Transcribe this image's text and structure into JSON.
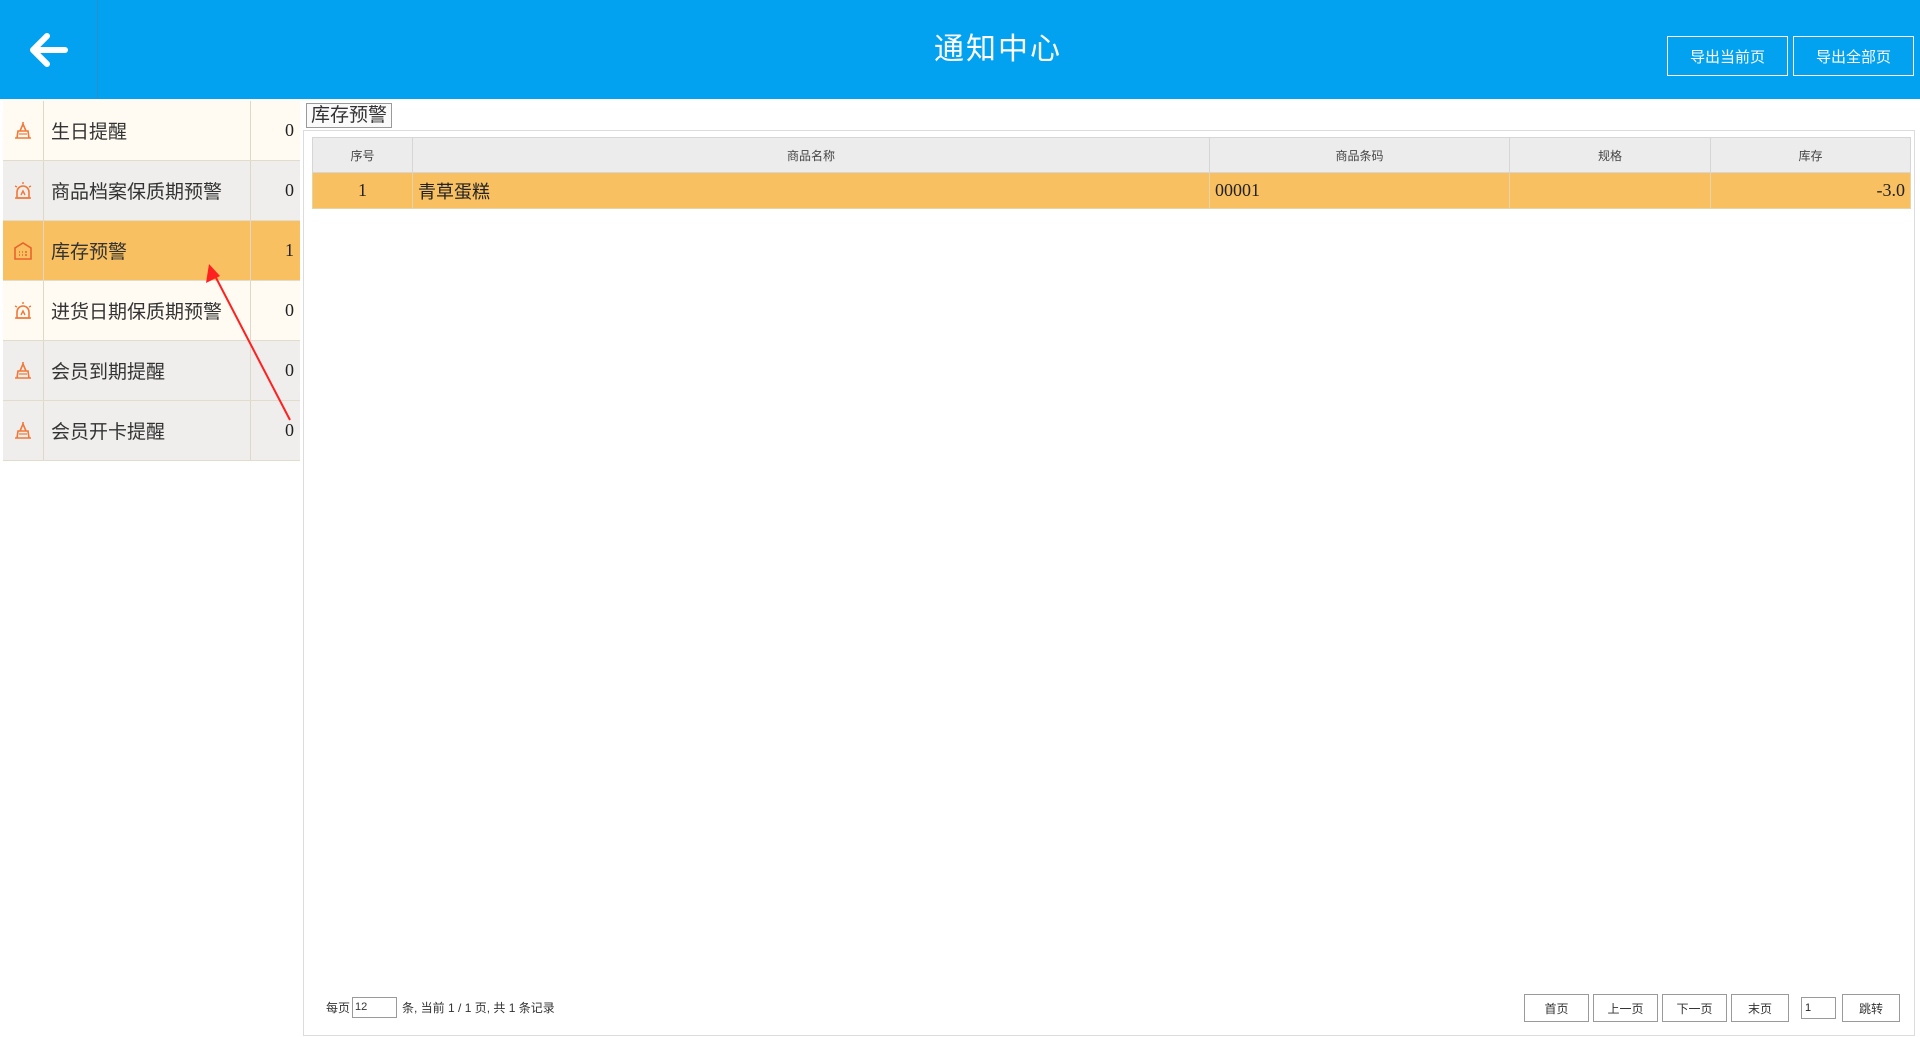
{
  "header": {
    "title": "通知中心",
    "export_current": "导出当前页",
    "export_all": "导出全部页"
  },
  "sidebar": {
    "items": [
      {
        "label": "生日提醒",
        "count": "0",
        "icon": "alarm-icon"
      },
      {
        "label": "商品档案保质期预警",
        "count": "0",
        "icon": "siren-icon"
      },
      {
        "label": "库存预警",
        "count": "1",
        "icon": "warehouse-icon",
        "active": true
      },
      {
        "label": "进货日期保质期预警",
        "count": "0",
        "icon": "siren-icon"
      },
      {
        "label": "会员到期提醒",
        "count": "0",
        "icon": "alarm-icon"
      },
      {
        "label": "会员开卡提醒",
        "count": "0",
        "icon": "alarm-icon"
      }
    ]
  },
  "tab": {
    "label": "库存预警"
  },
  "table": {
    "headers": [
      "序号",
      "商品名称",
      "商品条码",
      "规格",
      "库存"
    ],
    "rows": [
      {
        "index": "1",
        "name": "青草蛋糕",
        "barcode": "00001",
        "spec": "",
        "stock": "-3.0"
      }
    ]
  },
  "pager": {
    "per_page_label": "每页",
    "per_page_value": "12",
    "info": "条, 当前 1 / 1 页, 共 1 条记录",
    "first": "首页",
    "prev": "上一页",
    "next": "下一页",
    "last": "末页",
    "page_input": "1",
    "jump": "跳转"
  },
  "colors": {
    "header": "#03a2f0",
    "active_row": "#f8c061",
    "icon": "#f07838",
    "annotation_arrow": "#ff2020"
  }
}
